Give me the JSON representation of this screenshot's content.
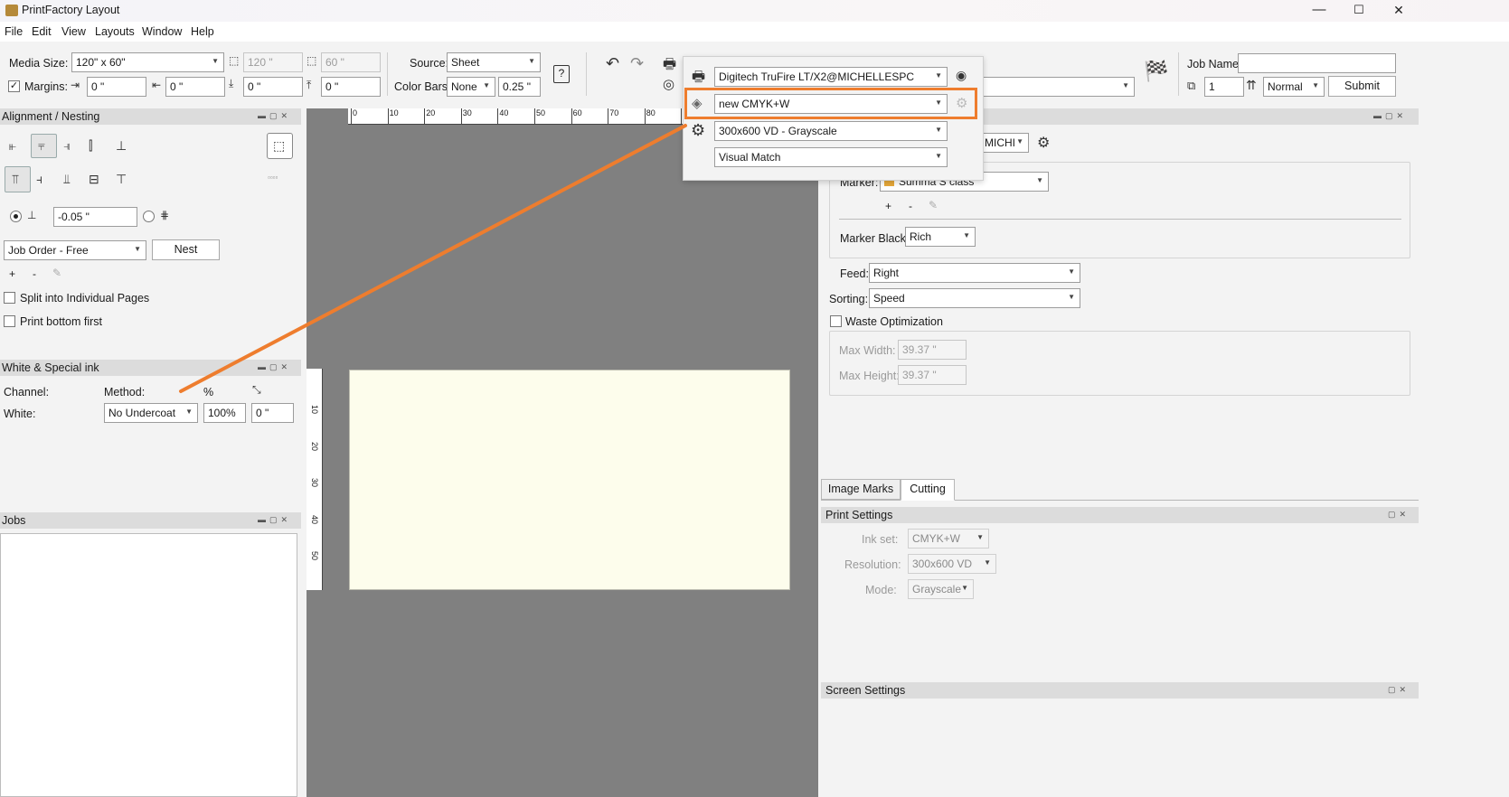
{
  "window": {
    "title": "PrintFactory Layout",
    "minimize": "—",
    "maximize": "☐",
    "close": "✕"
  },
  "menu": [
    {
      "label": "File"
    },
    {
      "label": "Edit"
    },
    {
      "label": "View"
    },
    {
      "label": "Layouts"
    },
    {
      "label": "Window"
    },
    {
      "label": "Help"
    }
  ],
  "toolbar": {
    "media_size_label": "Media Size:",
    "media_size_value": "120\" x 60\"",
    "width_value": "120 \"",
    "height_value": "60 \"",
    "margins_label": "Margins:",
    "margin_left": "0 \"",
    "margin_right": "0 \"",
    "margin_bottom": "0 \"",
    "margin_top": "0 \"",
    "source_label": "Source:",
    "source_value": "Sheet",
    "color_bars_label": "Color Bars:",
    "color_bars_value": "None",
    "color_bars_size": "0.25 \"",
    "help_glyph": "?",
    "job_name_label": "Job Name:",
    "job_name_value": "",
    "copies_value": "1",
    "priority_value": "Normal",
    "submit_label": "Submit"
  },
  "popup": {
    "printer": "Digitech TruFire LT/X2@MICHELLESPC",
    "ink_set": "new CMYK+W",
    "resolution_mode": "300x600 VD - Grayscale",
    "rendering": "Visual Match"
  },
  "alignment_panel": {
    "title": "Alignment / Nesting",
    "offset_value": "-0.05 \"",
    "order_value": "Job Order - Free",
    "nest_label": "Nest",
    "plus": "+",
    "minus": "-",
    "split_label": "Split into Individual Pages",
    "print_bottom_label": "Print bottom first",
    "dots": "▫▫▫▫"
  },
  "white_panel": {
    "title": "White & Special ink",
    "channel_label": "Channel:",
    "method_label": "Method:",
    "percent_label": "%",
    "white_label": "White:",
    "method_value": "No Undercoat",
    "percent_value": "100%",
    "offset_value": "0 \""
  },
  "jobs_panel": {
    "title": "Jobs"
  },
  "ruler": {
    "h_ticks": [
      "0",
      "10",
      "20",
      "30",
      "40",
      "50",
      "60",
      "70",
      "80",
      "9"
    ],
    "v_ticks": [
      "10",
      "20",
      "30",
      "40",
      "50"
    ]
  },
  "right_panel": {
    "marker_printer_value": "MICHI",
    "marker_label": "Marker:",
    "marker_value": "Summa S class",
    "plus": "+",
    "minus": "-",
    "marker_black_label": "Marker Black:",
    "marker_black_value": "Rich",
    "feed_label": "Feed:",
    "feed_value": "Right",
    "sorting_label": "Sorting:",
    "sorting_value": "Speed",
    "waste_label": "Waste Optimization",
    "max_width_label": "Max Width:",
    "max_width_value": "39.37 \"",
    "max_height_label": "Max Height:",
    "max_height_value": "39.37 \"",
    "tabs": [
      {
        "label": "Image Marks"
      },
      {
        "label": "Cutting"
      }
    ]
  },
  "print_settings": {
    "title": "Print Settings",
    "ink_set_label": "Ink set:",
    "ink_set_value": "CMYK+W",
    "resolution_label": "Resolution:",
    "resolution_value": "300x600 VD",
    "mode_label": "Mode:",
    "mode_value": "Grayscale"
  },
  "screen_settings": {
    "title": "Screen Settings"
  },
  "colors": {
    "highlight": "#ee7d2e",
    "canvas": "#808080",
    "sheet": "#fdfdec"
  }
}
